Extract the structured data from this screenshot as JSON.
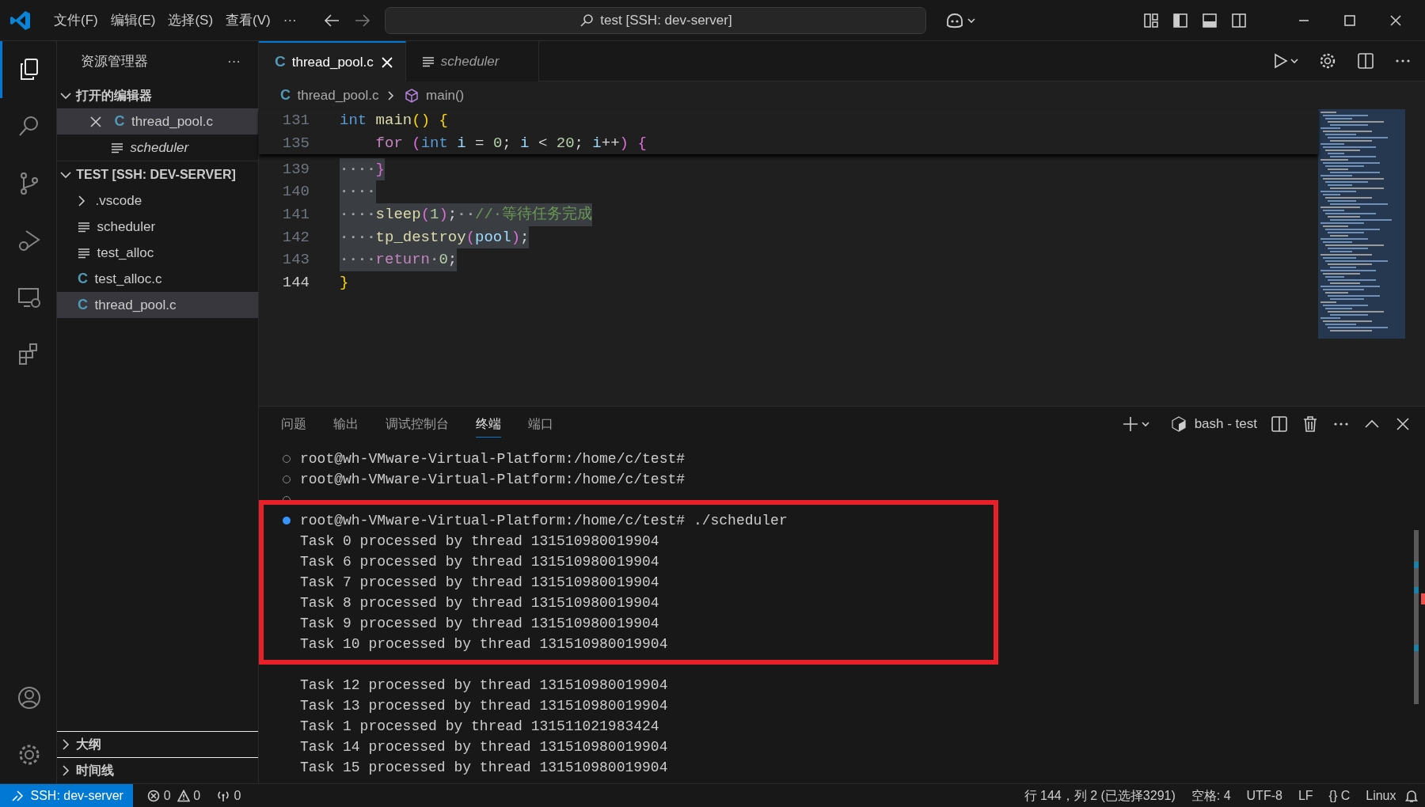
{
  "title_bar": {
    "menu": [
      "文件(F)",
      "编辑(E)",
      "选择(S)",
      "查看(V)",
      "···"
    ],
    "command_center": "test [SSH: dev-server]"
  },
  "activity_bar": [
    {
      "selected": true
    },
    {
      "selected": false
    },
    {
      "selected": false
    },
    {
      "selected": false
    },
    {
      "selected": false
    },
    {
      "selected": false
    }
  ],
  "sidebar": {
    "title": "资源管理器",
    "more": "···",
    "sections": [
      {
        "title": "打开的编辑器",
        "expanded": true,
        "items": [
          {
            "label": "thread_pool.c",
            "kind": "c",
            "glyph": "C",
            "italic": false,
            "closable": true,
            "selected": true
          },
          {
            "label": "scheduler",
            "kind": "binary",
            "italic": true,
            "closable": false,
            "selected": false
          }
        ]
      },
      {
        "title": "TEST [SSH: DEV-SERVER]",
        "expanded": true,
        "items": [
          {
            "label": ".vscode",
            "kind": "folder",
            "italic": false,
            "closable": false,
            "selected": false
          },
          {
            "label": "scheduler",
            "kind": "binary",
            "italic": false,
            "closable": false,
            "selected": false
          },
          {
            "label": "test_alloc",
            "kind": "binary",
            "italic": false,
            "closable": false,
            "selected": false
          },
          {
            "label": "test_alloc.c",
            "kind": "c",
            "glyph": "C",
            "italic": false,
            "closable": false,
            "selected": false
          },
          {
            "label": "thread_pool.c",
            "kind": "c",
            "glyph": "C",
            "italic": false,
            "closable": false,
            "selected": true
          }
        ]
      },
      {
        "title": "大纲",
        "expanded": false
      },
      {
        "title": "时间线",
        "expanded": false
      }
    ]
  },
  "editor": {
    "tabs": [
      {
        "label": "thread_pool.c",
        "kind": "c",
        "glyph": "C",
        "italic": false,
        "selected": true
      },
      {
        "label": "scheduler",
        "kind": "binary",
        "italic": true,
        "selected": false
      }
    ],
    "breadcrumb": [
      {
        "label": "thread_pool.c",
        "kind": "c",
        "glyph": "C"
      },
      {
        "label": "main()",
        "kind": "symbol"
      }
    ],
    "sticky_lines": [
      {
        "number": "131",
        "tokens": [
          {
            "text": "int",
            "kind": "type"
          },
          {
            "text": " main",
            "kind": "fn"
          },
          {
            "text": "()",
            "kind": "bracket1"
          },
          {
            "text": " {",
            "kind": "bracket1"
          }
        ]
      },
      {
        "number": "135",
        "tokens": [
          {
            "text": "    for",
            "kind": "control"
          },
          {
            "text": " (",
            "kind": "bracket2"
          },
          {
            "text": "int",
            "kind": "type"
          },
          {
            "text": " i",
            "kind": "var"
          },
          {
            "text": " =",
            "kind": "plain"
          },
          {
            "text": " 0",
            "kind": "num"
          },
          {
            "text": ";",
            "kind": "plain"
          },
          {
            "text": " i",
            "kind": "var"
          },
          {
            "text": " <",
            "kind": "plain"
          },
          {
            "text": " 20",
            "kind": "num"
          },
          {
            "text": ";",
            "kind": "plain"
          },
          {
            "text": " i",
            "kind": "var"
          },
          {
            "text": "++",
            "kind": "plain"
          },
          {
            "text": ")",
            "kind": "bracket2"
          },
          {
            "text": " {",
            "kind": "bracket2"
          }
        ]
      }
    ],
    "lines": [
      {
        "number": "139",
        "selected": true,
        "current": false,
        "tokens": [
          {
            "text": "····",
            "kind": "ws"
          },
          {
            "text": "}",
            "kind": "bracket2"
          }
        ]
      },
      {
        "number": "140",
        "selected": true,
        "current": false,
        "tokens": [
          {
            "text": "····",
            "kind": "ws"
          }
        ]
      },
      {
        "number": "141",
        "selected": true,
        "current": false,
        "tokens": [
          {
            "text": "····",
            "kind": "ws"
          },
          {
            "text": "sleep",
            "kind": "fn"
          },
          {
            "text": "(",
            "kind": "bracket2"
          },
          {
            "text": "1",
            "kind": "num"
          },
          {
            "text": ")",
            "kind": "bracket2"
          },
          {
            "text": ";",
            "kind": "plain"
          },
          {
            "text": "··",
            "kind": "ws"
          },
          {
            "text": "//·等待任务完成",
            "kind": "comment"
          }
        ]
      },
      {
        "number": "142",
        "selected": true,
        "current": false,
        "tokens": [
          {
            "text": "····",
            "kind": "ws"
          },
          {
            "text": "tp_destroy",
            "kind": "fn"
          },
          {
            "text": "(",
            "kind": "bracket2"
          },
          {
            "text": "pool",
            "kind": "var"
          },
          {
            "text": ")",
            "kind": "bracket2"
          },
          {
            "text": ";",
            "kind": "plain"
          }
        ]
      },
      {
        "number": "143",
        "selected": true,
        "current": false,
        "tokens": [
          {
            "text": "····",
            "kind": "ws"
          },
          {
            "text": "return",
            "kind": "control"
          },
          {
            "text": "·",
            "kind": "ws"
          },
          {
            "text": "0",
            "kind": "num"
          },
          {
            "text": ";",
            "kind": "plain"
          }
        ]
      },
      {
        "number": "144",
        "selected": false,
        "current": true,
        "tokens": [
          {
            "text": "}",
            "kind": "bracket1"
          }
        ]
      }
    ]
  },
  "panel": {
    "tabs": [
      {
        "label": "问题",
        "selected": false
      },
      {
        "label": "输出",
        "selected": false
      },
      {
        "label": "调试控制台",
        "selected": false
      },
      {
        "label": "终端",
        "selected": true
      },
      {
        "label": "端口",
        "selected": false
      }
    ],
    "terminal_name": "bash - test",
    "terminal": [
      {
        "kind": "plain",
        "lines": [
          {
            "text": "root@wh-VMware-Virtual-Platform:/home/c/test#",
            "marked": true,
            "active": false
          },
          {
            "text": "root@wh-VMware-Virtual-Platform:/home/c/test#",
            "marked": true,
            "active": false
          },
          {
            "marked": true,
            "active": false
          }
        ]
      },
      {
        "kind": "highlighted",
        "lines": [
          {
            "text": "root@wh-VMware-Virtual-Platform:/home/c/test# ./scheduler",
            "marked": true,
            "active": true
          },
          {
            "text": "Task 0 processed by thread 131510980019904",
            "marked": false
          },
          {
            "text": "Task 6 processed by thread 131510980019904",
            "marked": false
          },
          {
            "text": "Task 7 processed by thread 131510980019904",
            "marked": false
          },
          {
            "text": "Task 8 processed by thread 131510980019904",
            "marked": false
          },
          {
            "text": "Task 9 processed by thread 131510980019904",
            "marked": false
          },
          {
            "text": "Task 10 processed by thread 131510980019904",
            "marked": false
          }
        ]
      },
      {
        "kind": "plain",
        "lines": [
          {
            "marked": false
          },
          {
            "text": "Task 12 processed by thread 131510980019904",
            "marked": false
          },
          {
            "text": "Task 13 processed by thread 131510980019904",
            "marked": false
          },
          {
            "text": "Task 1 processed by thread 131511021983424",
            "marked": false
          },
          {
            "text": "Task 14 processed by thread 131510980019904",
            "marked": false
          },
          {
            "text": "Task 15 processed by thread 131510980019904",
            "marked": false
          }
        ]
      }
    ]
  },
  "status_bar": {
    "remote": "SSH: dev-server",
    "errors": "0",
    "warnings": "0",
    "ports": "0",
    "right": [
      "行 144，列 2 (已选择3291)",
      "空格: 4",
      "UTF-8",
      "LF",
      "{} C",
      "Linux"
    ]
  }
}
